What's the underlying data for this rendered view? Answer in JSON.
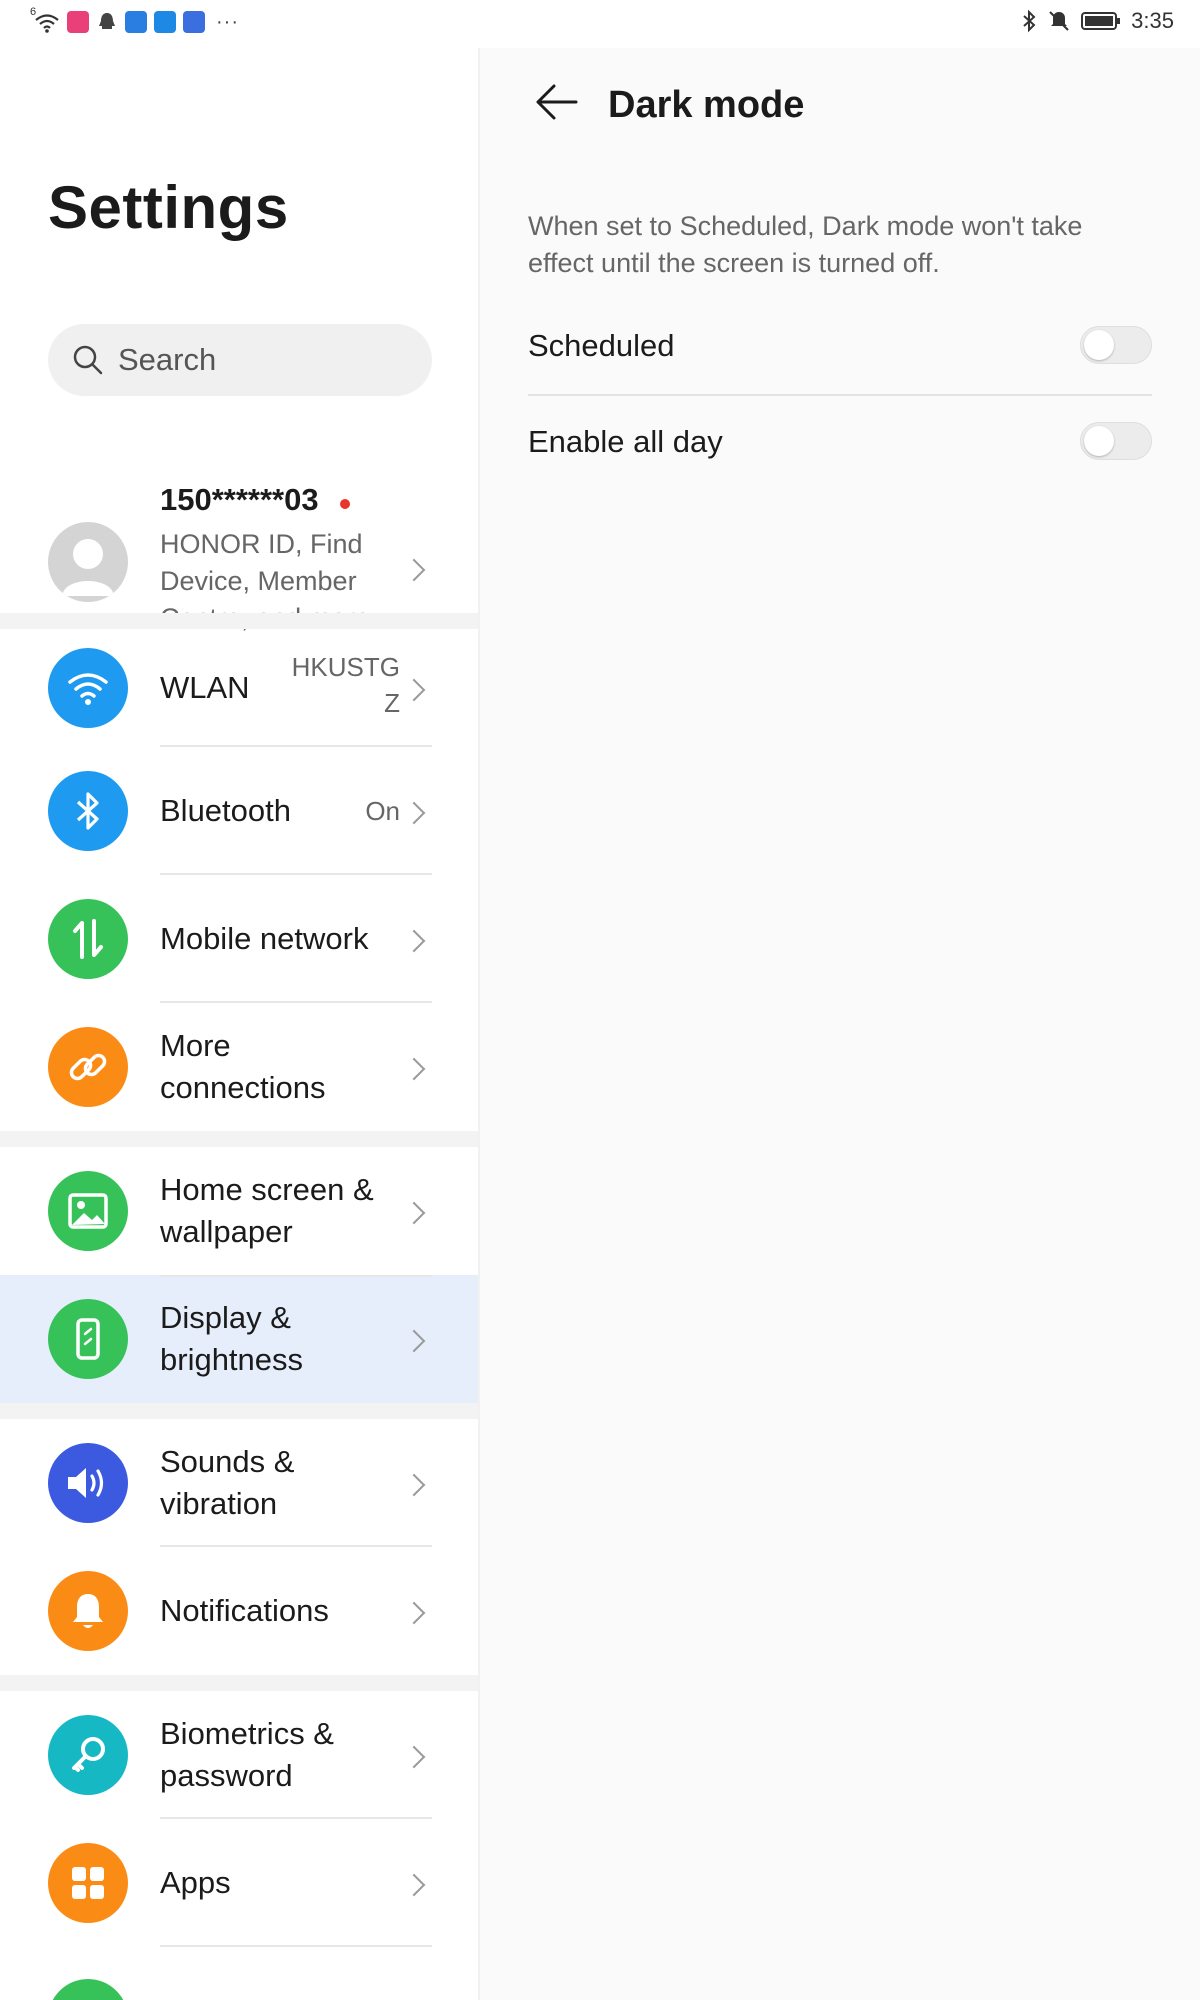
{
  "status_bar": {
    "signal_label": "6",
    "overflow": "···",
    "time": "3:35",
    "icons": [
      "wifi-icon",
      "app-pink-icon",
      "qq-icon",
      "app-blue-icon",
      "cloud-icon",
      "app-blue2-icon",
      "bluetooth-icon",
      "mute-icon",
      "battery-icon"
    ]
  },
  "left_pane": {
    "title": "Settings",
    "search": {
      "placeholder": "Search"
    },
    "account": {
      "name": "150******03",
      "subtitle": "HONOR ID, Find Device, Member Centre, and more"
    },
    "items": [
      {
        "label": "WLAN",
        "value": "HKUSTG Z",
        "icon": "wifi-icon",
        "color": "#1e9bf0"
      },
      {
        "label": "Bluetooth",
        "value": "On",
        "icon": "bluetooth-icon",
        "color": "#1e9bf0"
      },
      {
        "label": "Mobile network",
        "value": "",
        "icon": "mobile-data-icon",
        "color": "#36c259"
      },
      {
        "label": "More connections",
        "value": "",
        "icon": "link-icon",
        "color": "#fa8c16"
      },
      {
        "label": "Home screen & wallpaper",
        "value": "",
        "icon": "image-icon",
        "color": "#36c259"
      },
      {
        "label": "Display & brightness",
        "value": "",
        "icon": "display-icon",
        "color": "#36c259",
        "selected": true
      },
      {
        "label": "Sounds & vibration",
        "value": "",
        "icon": "speaker-icon",
        "color": "#3c5ae0"
      },
      {
        "label": "Notifications",
        "value": "",
        "icon": "bell-icon",
        "color": "#fa8c16"
      },
      {
        "label": "Biometrics & password",
        "value": "",
        "icon": "key-icon",
        "color": "#16b8c4"
      },
      {
        "label": "Apps",
        "value": "",
        "icon": "apps-icon",
        "color": "#fa8c16"
      }
    ]
  },
  "right_pane": {
    "title": "Dark mode",
    "description": "When set to Scheduled, Dark mode won't take effect until the screen is turned off.",
    "options": [
      {
        "label": "Scheduled",
        "enabled": false
      },
      {
        "label": "Enable all day",
        "enabled": false
      }
    ]
  }
}
